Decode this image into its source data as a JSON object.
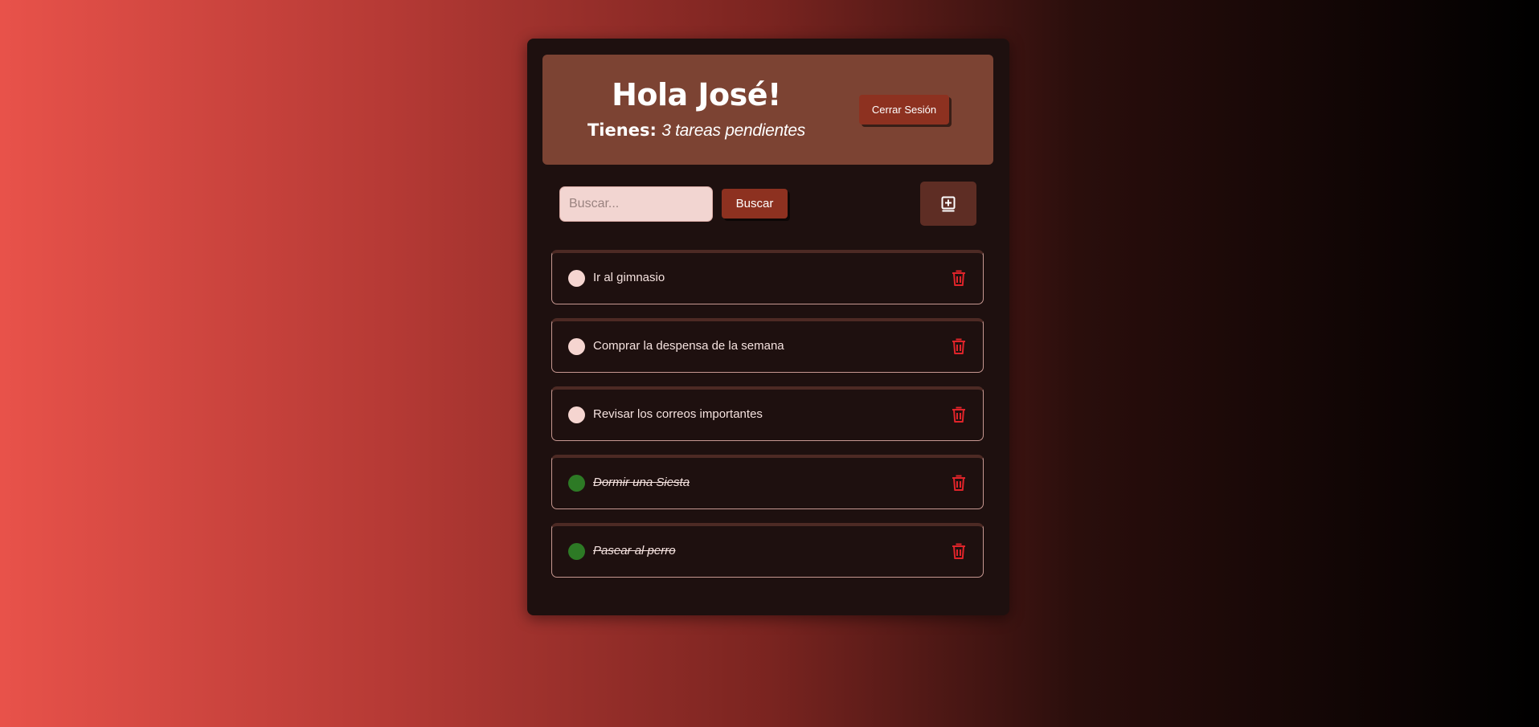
{
  "header": {
    "greeting": "Hola José!",
    "pending_label": "Tienes:",
    "pending_count": "3 tareas pendientes",
    "logout_label": "Cerrar Sesión"
  },
  "search": {
    "placeholder": "Buscar...",
    "value": "",
    "button_label": "Buscar"
  },
  "add_button": {
    "icon": "add-note-icon"
  },
  "tasks": [
    {
      "text": "Ir al gimnasio",
      "completed": false
    },
    {
      "text": "Comprar la despensa de la semana",
      "completed": false
    },
    {
      "text": "Revisar los correos importantes",
      "completed": false
    },
    {
      "text": "Dormir una Siesta",
      "completed": true
    },
    {
      "text": "Pasear al perro",
      "completed": true
    }
  ],
  "colors": {
    "accent": "#8d3120",
    "header_bg": "#7c4333",
    "card_bg": "#1e100f",
    "pending_circle": "#f5d5d0",
    "done_circle": "#2d7a25",
    "trash": "#e0242a"
  }
}
